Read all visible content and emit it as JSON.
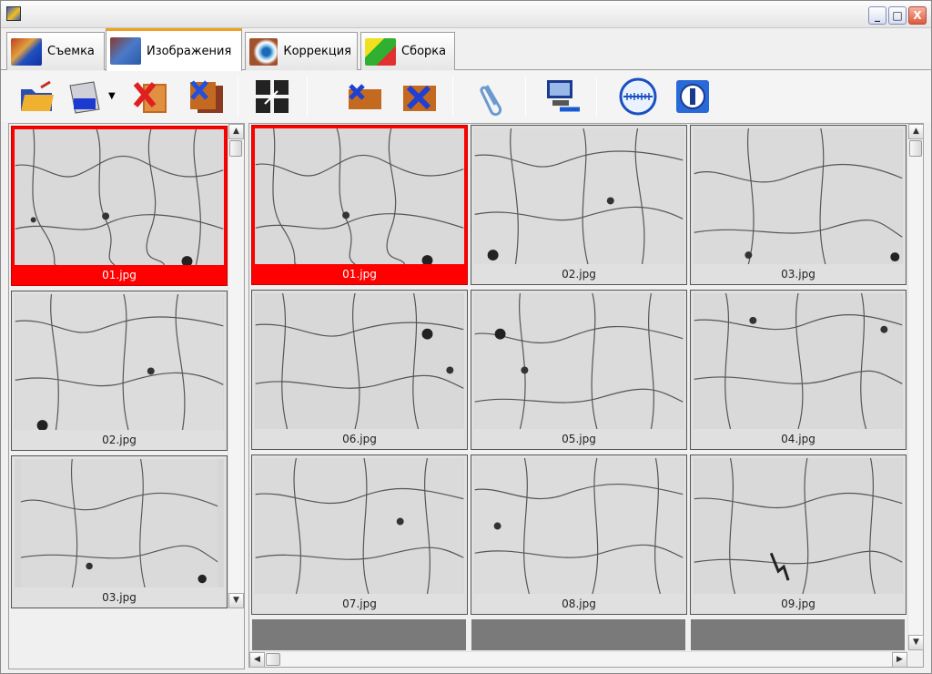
{
  "window": {
    "title": "",
    "controls": {
      "minimize": "_",
      "maximize": "□",
      "close": "X"
    }
  },
  "tabs": [
    {
      "label": "Съемка",
      "active": false,
      "icon": "microscope-icon"
    },
    {
      "label": "Изображения",
      "active": true,
      "icon": "images-icon"
    },
    {
      "label": "Коррекция",
      "active": false,
      "icon": "eye-icon"
    },
    {
      "label": "Сборка",
      "active": false,
      "icon": "cube-icon"
    }
  ],
  "toolbar": {
    "buttons": [
      {
        "name": "open-folder-button",
        "icon": "open-folder-icon"
      },
      {
        "name": "scanner-button",
        "icon": "scanner-icon",
        "has_dropdown": true
      },
      {
        "name": "delete-image-button",
        "icon": "delete-image-icon"
      },
      {
        "name": "delete-stack-button",
        "icon": "delete-stack-icon"
      },
      {
        "name": "arrange-button",
        "icon": "grid-arrange-icon"
      },
      {
        "name": "delete-selected-button",
        "icon": "delete-selected-icon"
      },
      {
        "name": "delete-all-button",
        "icon": "delete-all-icon"
      },
      {
        "name": "attach-button",
        "icon": "paperclip-icon"
      },
      {
        "name": "device-settings-button",
        "icon": "computer-wrench-icon"
      },
      {
        "name": "scale-button",
        "icon": "scale-ruler-icon"
      },
      {
        "name": "info-button",
        "icon": "info-icon"
      }
    ]
  },
  "left_list": {
    "items": [
      {
        "caption": "01.jpg",
        "selected": true
      },
      {
        "caption": "02.jpg",
        "selected": false
      },
      {
        "caption": "03.jpg",
        "selected": false
      }
    ]
  },
  "gallery": {
    "items": [
      {
        "caption": "01.jpg",
        "selected": true
      },
      {
        "caption": "02.jpg",
        "selected": false
      },
      {
        "caption": "03.jpg",
        "selected": false
      },
      {
        "caption": "06.jpg",
        "selected": false
      },
      {
        "caption": "05.jpg",
        "selected": false
      },
      {
        "caption": "04.jpg",
        "selected": false
      },
      {
        "caption": "07.jpg",
        "selected": false
      },
      {
        "caption": "08.jpg",
        "selected": false
      },
      {
        "caption": "09.jpg",
        "selected": false
      }
    ]
  },
  "scroll": {
    "up": "▲",
    "down": "▼",
    "left": "◀",
    "right": "▶"
  }
}
